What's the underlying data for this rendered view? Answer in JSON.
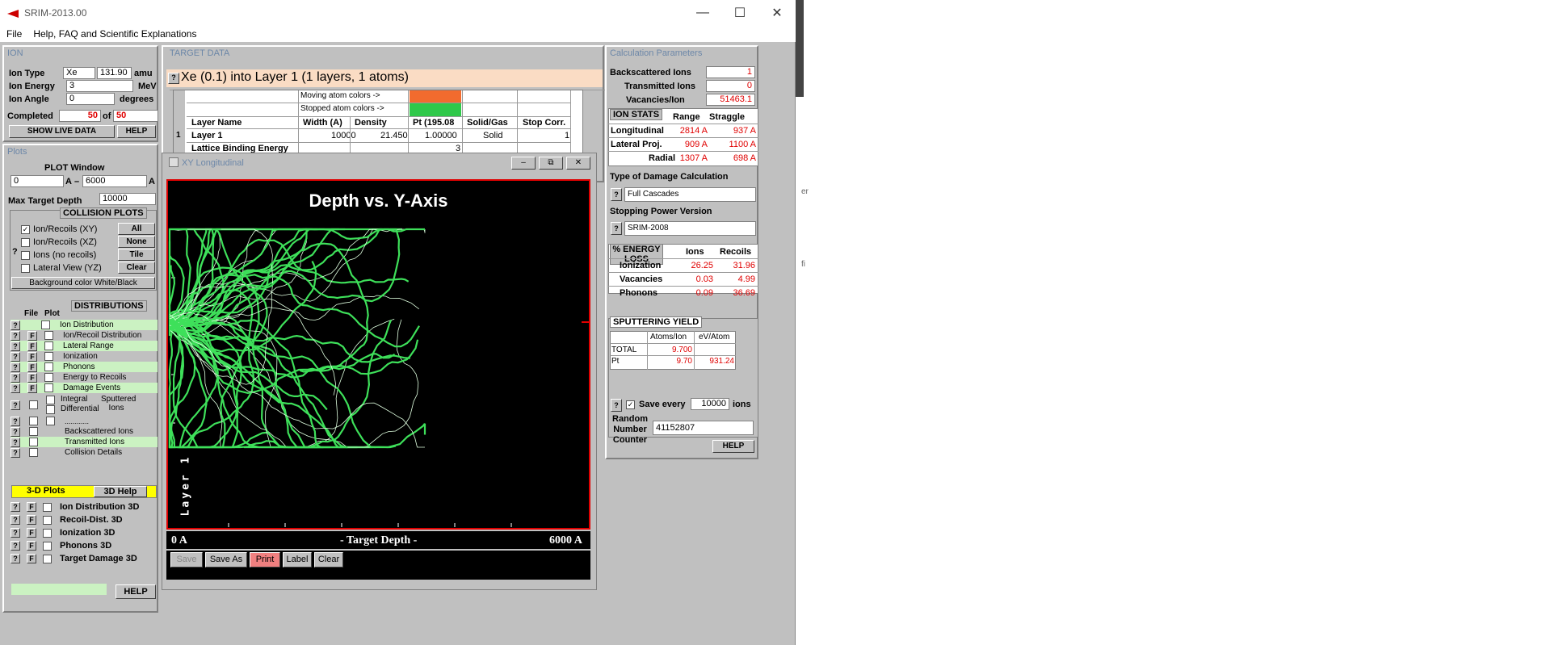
{
  "window": {
    "title": "SRIM-2013.00",
    "minimize": "—",
    "maximize": "☐",
    "close": "✕"
  },
  "menu": [
    "File",
    "Help, FAQ and Scientific Explanations"
  ],
  "ion": {
    "title": "ION",
    "type_label": "Ion Type",
    "type": "Xe",
    "mass": "131.90",
    "mass_unit": "amu",
    "energy_label": "Ion Energy",
    "energy": "3",
    "energy_unit": "MeV",
    "angle_label": "Ion Angle",
    "angle": "0",
    "angle_unit": "degrees",
    "completed_label": "Completed",
    "completed": "50",
    "of_label": "of",
    "total": "50",
    "show_live": "SHOW LIVE DATA",
    "help": "HELP"
  },
  "plots": {
    "title": "Plots",
    "window_label": "PLOT  Window",
    "from": "0",
    "from_unit": "A",
    "dash": "–",
    "to": "6000",
    "to_unit": "A",
    "max_depth_label": "Max Target Depth",
    "max_depth": "10000",
    "collision_title": "COLLISION PLOTS",
    "collision_items": [
      {
        "label": "Ion/Recoils (XY)",
        "checked": "✓"
      },
      {
        "label": "Ion/Recoils (XZ)",
        "checked": ""
      },
      {
        "label": "Ions (no recoils)",
        "checked": ""
      },
      {
        "label": "Lateral View (YZ)",
        "checked": ""
      }
    ],
    "collision_buttons": [
      "All",
      "None",
      "Tile",
      "Clear"
    ],
    "q": "?",
    "bgcolor": "Background color White/Black",
    "file_label": "File",
    "plot_label": "Plot",
    "dist_title": "DISTRIBUTIONS",
    "f": "F",
    "dist_items": [
      "Ion Distribution",
      "Ion/Recoil Distribution",
      "Lateral Range",
      "Ionization",
      "Phonons",
      "Energy to Recoils",
      "Damage Events"
    ],
    "integral": "Integral",
    "differential": "Differential",
    "sputtered": "Sputtered Ions",
    "dots": "............",
    "extra_items": [
      "Backscattered Ions",
      "Transmitted Ions",
      "Collision Details"
    ],
    "plots3d": "3-D Plots",
    "help3d": "3D Help",
    "items3d": [
      "Ion Distribution 3D",
      "Recoil-Dist. 3D",
      "Ionization 3D",
      "Phonons 3D",
      "Target Damage 3D"
    ],
    "help": "HELP"
  },
  "target": {
    "title": "TARGET DATA",
    "q": "?",
    "banner": "Xe (0.1) into Layer 1 (1 layers, 1 atoms)",
    "moving": "Moving atom colors ->",
    "stopped": "Stopped atom colors ->",
    "moving_color": "#f26b2e",
    "stopped_color": "#2fc84a",
    "headers": [
      "Layer Name",
      "Width (A)",
      "Density",
      "Pt (195.08",
      "Solid/Gas",
      "Stop Corr."
    ],
    "row": {
      "num": "1",
      "name": "Layer 1",
      "width": "10000",
      "density": "21.450",
      "pt": "1.00000",
      "phase": "Solid",
      "stop": "1"
    },
    "lattice_label": "Lattice Binding Energy",
    "lattice": "3"
  },
  "xy": {
    "title": "XY Longitudinal",
    "chart_title": "Depth vs. Y-Axis",
    "axis_left": "0 A",
    "axis_mid": "- Target Depth -",
    "axis_right": "6000 A",
    "layer_label": "Layer 1",
    "buttons": [
      "Save",
      "Save As",
      "Print",
      "Label",
      "Clear"
    ]
  },
  "calc": {
    "title": "Calculation Parameters",
    "backscattered_label": "Backscattered Ions",
    "backscattered": "1",
    "transmitted_label": "Transmitted Ions",
    "transmitted": "0",
    "vacancies_label": "Vacancies/Ion",
    "vacancies": "51463.1",
    "stats_title": "ION STATS",
    "range_h": "Range",
    "straggle_h": "Straggle",
    "stats": [
      {
        "label": "Longitudinal",
        "range": "2814 A",
        "straggle": "937 A"
      },
      {
        "label": "Lateral Proj.",
        "range": "909 A",
        "straggle": "1100 A"
      },
      {
        "label": "Radial",
        "range": "1307 A",
        "straggle": "698 A"
      }
    ],
    "damage_title": "Type of Damage Calculation",
    "damage": "Full Cascades",
    "stopping_title": "Stopping Power Version",
    "stopping": "SRIM-2008",
    "q": "?",
    "energy_title": "% ENERGY LOSS",
    "ions_h": "Ions",
    "recoils_h": "Recoils",
    "energy": [
      {
        "label": "Ionization",
        "ions": "26.25",
        "recoils": "31.96"
      },
      {
        "label": "Vacancies",
        "ions": "0.03",
        "recoils": "4.99"
      },
      {
        "label": "Phonons",
        "ions": "0.09",
        "recoils": "36.69"
      }
    ],
    "sputter_title": "SPUTTERING YIELD",
    "atoms_h": "Atoms/Ion",
    "ev_h": "eV/Atom",
    "sputter": [
      {
        "label": "TOTAL",
        "atoms": "9.700",
        "ev": ""
      },
      {
        "label": "Pt",
        "atoms": "9.70",
        "ev": "931.24"
      }
    ],
    "save_every_label": "Save every",
    "save_every": "10000",
    "save_unit": "ions",
    "save_check": "✓",
    "random_label": "Random Number Counter",
    "random": "41152807",
    "help": "HELP"
  },
  "right_edge": {
    "text1": "er",
    "text2": "fi"
  }
}
